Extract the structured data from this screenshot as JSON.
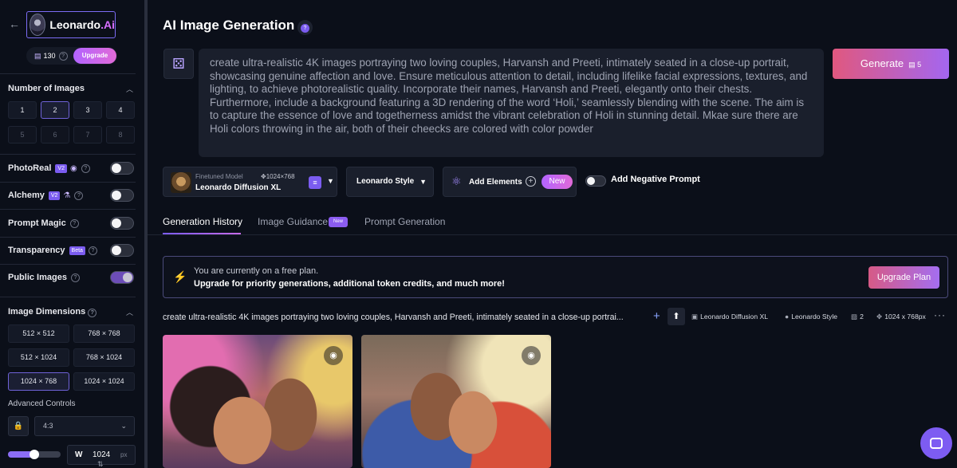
{
  "sidebar": {
    "brand": "Leonardo",
    "brand_suffix": ".Ai",
    "tokens": "130",
    "upgrade_label": "Upgrade",
    "number_of_images": {
      "title": "Number of Images",
      "options": [
        "1",
        "2",
        "3",
        "4",
        "5",
        "6",
        "7",
        "8"
      ],
      "selected": "2"
    },
    "toggles": [
      {
        "label": "PhotoReal",
        "badge": "V2",
        "on": false
      },
      {
        "label": "Alchemy",
        "badge": "V2",
        "on": false
      },
      {
        "label": "Prompt Magic",
        "on": false
      },
      {
        "label": "Transparency",
        "badge": "Beta",
        "on": false
      },
      {
        "label": "Public Images",
        "on": true
      }
    ],
    "image_dimensions": {
      "title": "Image Dimensions",
      "options": [
        "512 × 512",
        "768 × 768",
        "512 × 1024",
        "768 × 1024",
        "1024 × 768",
        "1024 × 1024"
      ],
      "selected": "1024 × 768"
    },
    "advanced_controls_label": "Advanced Controls",
    "aspect_ratio": "4:3",
    "width_label": "W",
    "width_value": "1024",
    "width_unit": "px",
    "slider_fraction": 0.5
  },
  "main": {
    "title": "AI Image Generation",
    "help_mark": "?",
    "prompt": "create ultra-realistic 4K images portraying two loving couples, Harvansh and Preeti, intimately seated in a close-up portrait, showcasing genuine affection and love. Ensure meticulous attention to detail, including lifelike facial expressions, textures, and lighting, to achieve photorealistic quality. Incorporate their names, Harvansh and Preeti, elegantly onto their chests. Furthermore, include a background featuring a 3D rendering of the word ‘Holi,’ seamlessly blending with the scene. The aim is to capture the essence of love and togetherness amidst the vibrant celebration of Holi in stunning detail. Mkae sure there are Holi colors throwing in the air, both of their cheecks are colored with color powder",
    "generate_label": "Generate",
    "generate_cost": "5",
    "model": {
      "kicker": "Finetuned Model",
      "resolution": "1024×768",
      "name": "Leonardo Diffusion XL"
    },
    "style": "Leonardo Style",
    "add_elements_label": "Add Elements",
    "new_label": "New",
    "negative_prompt_label": "Add Negative Prompt",
    "tabs": [
      "Generation History",
      "Image Guidance",
      "Prompt Generation"
    ],
    "tab_new_badge": "New",
    "banner": {
      "line1": "You are currently on a free plan.",
      "line2": "Upgrade for priority generations, additional token credits, and much more!",
      "button": "Upgrade Plan"
    },
    "generation": {
      "prompt_preview": "create ultra-realistic 4K images portraying two loving couples, Harvansh and Preeti, intimately seated in a close-up portrai...",
      "model": "Leonardo Diffusion XL",
      "style": "Leonardo Style",
      "count": "2",
      "size": "1024 x 768px",
      "more": "···"
    }
  },
  "icons": {
    "back": "←",
    "dice": "⚄",
    "bolt": "⚡",
    "eye": "👁",
    "chevron_up": "⌃",
    "chevron_down": "⌄",
    "lock": "🔒"
  }
}
